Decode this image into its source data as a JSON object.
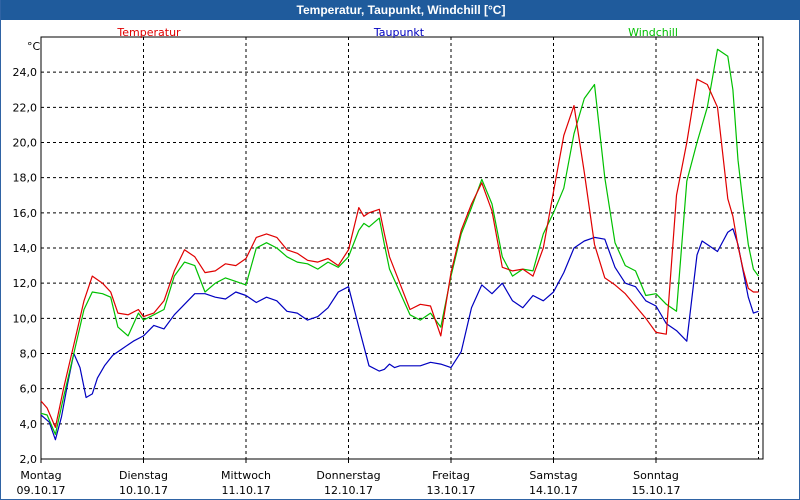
{
  "window": {
    "title": "Temperatur, Taupunkt, Windchill [°C]"
  },
  "chart_data": {
    "type": "line",
    "unit": "°C",
    "ylim": [
      2.0,
      26.0
    ],
    "yticks": [
      "2,0",
      "4,0",
      "6,0",
      "8,0",
      "10,0",
      "12,0",
      "14,0",
      "16,0",
      "18,0",
      "20,0",
      "22,0",
      "24,0"
    ],
    "xlim": [
      0,
      7
    ],
    "xticks": [
      {
        "day": "Montag",
        "date": "09.10.17"
      },
      {
        "day": "Dienstag",
        "date": "10.10.17"
      },
      {
        "day": "Mittwoch",
        "date": "11.10.17"
      },
      {
        "day": "Donnerstag",
        "date": "12.10.17"
      },
      {
        "day": "Freitag",
        "date": "13.10.17"
      },
      {
        "day": "Samstag",
        "date": "14.10.17"
      },
      {
        "day": "Sonntag",
        "date": "15.10.17"
      }
    ],
    "grid": true,
    "series": [
      {
        "name": "Taupunkt",
        "color": "#0000c0",
        "x": [
          0,
          0.08,
          0.14,
          0.2,
          0.26,
          0.32,
          0.38,
          0.44,
          0.5,
          0.55,
          0.62,
          0.7,
          0.8,
          0.9,
          1.0,
          1.1,
          1.2,
          1.3,
          1.4,
          1.5,
          1.6,
          1.7,
          1.8,
          1.9,
          2.0,
          2.1,
          2.2,
          2.3,
          2.4,
          2.5,
          2.6,
          2.7,
          2.8,
          2.9,
          3.0,
          3.1,
          3.2,
          3.3,
          3.35,
          3.4,
          3.45,
          3.5,
          3.58,
          3.7,
          3.8,
          3.9,
          4.0,
          4.1,
          4.2,
          4.3,
          4.4,
          4.5,
          4.6,
          4.7,
          4.8,
          4.9,
          5.0,
          5.1,
          5.2,
          5.3,
          5.4,
          5.5,
          5.6,
          5.7,
          5.8,
          5.9,
          6.0,
          6.1,
          6.2,
          6.3,
          6.4,
          6.45,
          6.5,
          6.55,
          6.6,
          6.7,
          6.75,
          6.8,
          6.85,
          6.9,
          6.95,
          7.0
        ],
        "values": [
          4.5,
          4.1,
          3.1,
          4.4,
          6.3,
          8.0,
          7.2,
          5.5,
          5.7,
          6.6,
          7.3,
          7.9,
          8.3,
          8.7,
          9.0,
          9.6,
          9.4,
          10.2,
          10.8,
          11.4,
          11.4,
          11.2,
          11.1,
          11.5,
          11.3,
          10.9,
          11.2,
          11.0,
          10.4,
          10.3,
          9.9,
          10.1,
          10.6,
          11.5,
          11.8,
          9.5,
          7.3,
          7.0,
          7.1,
          7.4,
          7.2,
          7.3,
          7.3,
          7.3,
          7.5,
          7.4,
          7.2,
          8.1,
          10.6,
          11.9,
          11.4,
          12.0,
          11.0,
          10.6,
          11.3,
          11.0,
          11.5,
          12.6,
          14.0,
          14.4,
          14.6,
          14.5,
          12.9,
          12.0,
          11.8,
          11.0,
          10.7,
          9.7,
          9.3,
          8.7,
          13.6,
          14.4,
          14.2,
          14.0,
          13.8,
          14.9,
          15.1,
          14.2,
          12.7,
          11.2,
          10.3,
          10.4
        ]
      },
      {
        "name": "Windchill",
        "color": "#00c000",
        "x": [
          0,
          0.06,
          0.14,
          0.22,
          0.32,
          0.42,
          0.5,
          0.6,
          0.68,
          0.75,
          0.85,
          0.95,
          1.0,
          1.1,
          1.2,
          1.3,
          1.4,
          1.5,
          1.6,
          1.7,
          1.8,
          1.9,
          2.0,
          2.1,
          2.2,
          2.3,
          2.4,
          2.5,
          2.6,
          2.7,
          2.8,
          2.9,
          3.0,
          3.1,
          3.15,
          3.2,
          3.3,
          3.35,
          3.4,
          3.5,
          3.6,
          3.7,
          3.8,
          3.9,
          4.0,
          4.1,
          4.2,
          4.3,
          4.4,
          4.5,
          4.6,
          4.7,
          4.8,
          4.9,
          5.0,
          5.1,
          5.2,
          5.3,
          5.4,
          5.5,
          5.6,
          5.7,
          5.8,
          5.9,
          6.0,
          6.1,
          6.2,
          6.3,
          6.4,
          6.5,
          6.6,
          6.7,
          6.75,
          6.8,
          6.85,
          6.9,
          6.95,
          7.0
        ],
        "values": [
          4.6,
          4.5,
          3.4,
          5.5,
          8.0,
          10.5,
          11.5,
          11.4,
          11.2,
          9.5,
          9.0,
          10.3,
          9.9,
          10.2,
          10.5,
          12.4,
          13.2,
          13.0,
          11.5,
          12.0,
          12.3,
          12.1,
          11.9,
          14.0,
          14.3,
          14.0,
          13.5,
          13.2,
          13.1,
          12.8,
          13.2,
          12.9,
          13.5,
          15.0,
          15.4,
          15.2,
          15.7,
          14.2,
          12.8,
          11.5,
          10.2,
          9.9,
          10.3,
          9.5,
          12.4,
          14.8,
          16.3,
          17.9,
          16.5,
          13.5,
          12.4,
          12.8,
          12.7,
          14.8,
          16.0,
          17.4,
          20.5,
          22.5,
          23.3,
          18.0,
          14.3,
          13.0,
          12.7,
          11.3,
          11.4,
          10.8,
          10.4,
          17.8,
          20.0,
          22.0,
          25.3,
          24.9,
          23.0,
          19.0,
          16.5,
          14.2,
          12.8,
          12.4
        ]
      },
      {
        "name": "Temperatur",
        "color": "#e00000",
        "x": [
          0,
          0.06,
          0.14,
          0.22,
          0.32,
          0.42,
          0.5,
          0.6,
          0.68,
          0.75,
          0.85,
          0.95,
          1.0,
          1.1,
          1.2,
          1.3,
          1.4,
          1.5,
          1.6,
          1.7,
          1.8,
          1.9,
          2.0,
          2.1,
          2.2,
          2.3,
          2.4,
          2.5,
          2.6,
          2.7,
          2.8,
          2.9,
          3.0,
          3.1,
          3.15,
          3.2,
          3.3,
          3.35,
          3.4,
          3.5,
          3.6,
          3.7,
          3.8,
          3.9,
          4.0,
          4.1,
          4.2,
          4.3,
          4.4,
          4.5,
          4.6,
          4.7,
          4.8,
          4.9,
          5.0,
          5.1,
          5.2,
          5.3,
          5.4,
          5.5,
          5.6,
          5.7,
          5.8,
          5.9,
          6.0,
          6.1,
          6.2,
          6.3,
          6.4,
          6.5,
          6.6,
          6.7,
          6.75,
          6.8,
          6.85,
          6.9,
          6.95,
          7.0
        ],
        "values": [
          5.3,
          4.9,
          3.8,
          6.0,
          8.5,
          11.0,
          12.4,
          12.0,
          11.5,
          10.3,
          10.2,
          10.5,
          10.1,
          10.3,
          11.0,
          12.7,
          13.9,
          13.5,
          12.6,
          12.7,
          13.1,
          13.0,
          13.4,
          14.6,
          14.8,
          14.6,
          13.9,
          13.7,
          13.3,
          13.2,
          13.4,
          13.0,
          13.9,
          16.3,
          15.8,
          16.0,
          16.2,
          14.8,
          13.5,
          12.0,
          10.5,
          10.8,
          10.7,
          9.0,
          12.6,
          15.0,
          16.5,
          17.7,
          16.1,
          12.9,
          12.7,
          12.8,
          12.4,
          14.0,
          17.2,
          20.4,
          22.1,
          18.3,
          14.2,
          12.3,
          11.9,
          11.4,
          10.7,
          10.0,
          9.2,
          9.1,
          17.0,
          20.0,
          23.6,
          23.3,
          22.0,
          16.8,
          15.8,
          14.1,
          12.8,
          11.7,
          11.5,
          11.5
        ]
      }
    ]
  }
}
